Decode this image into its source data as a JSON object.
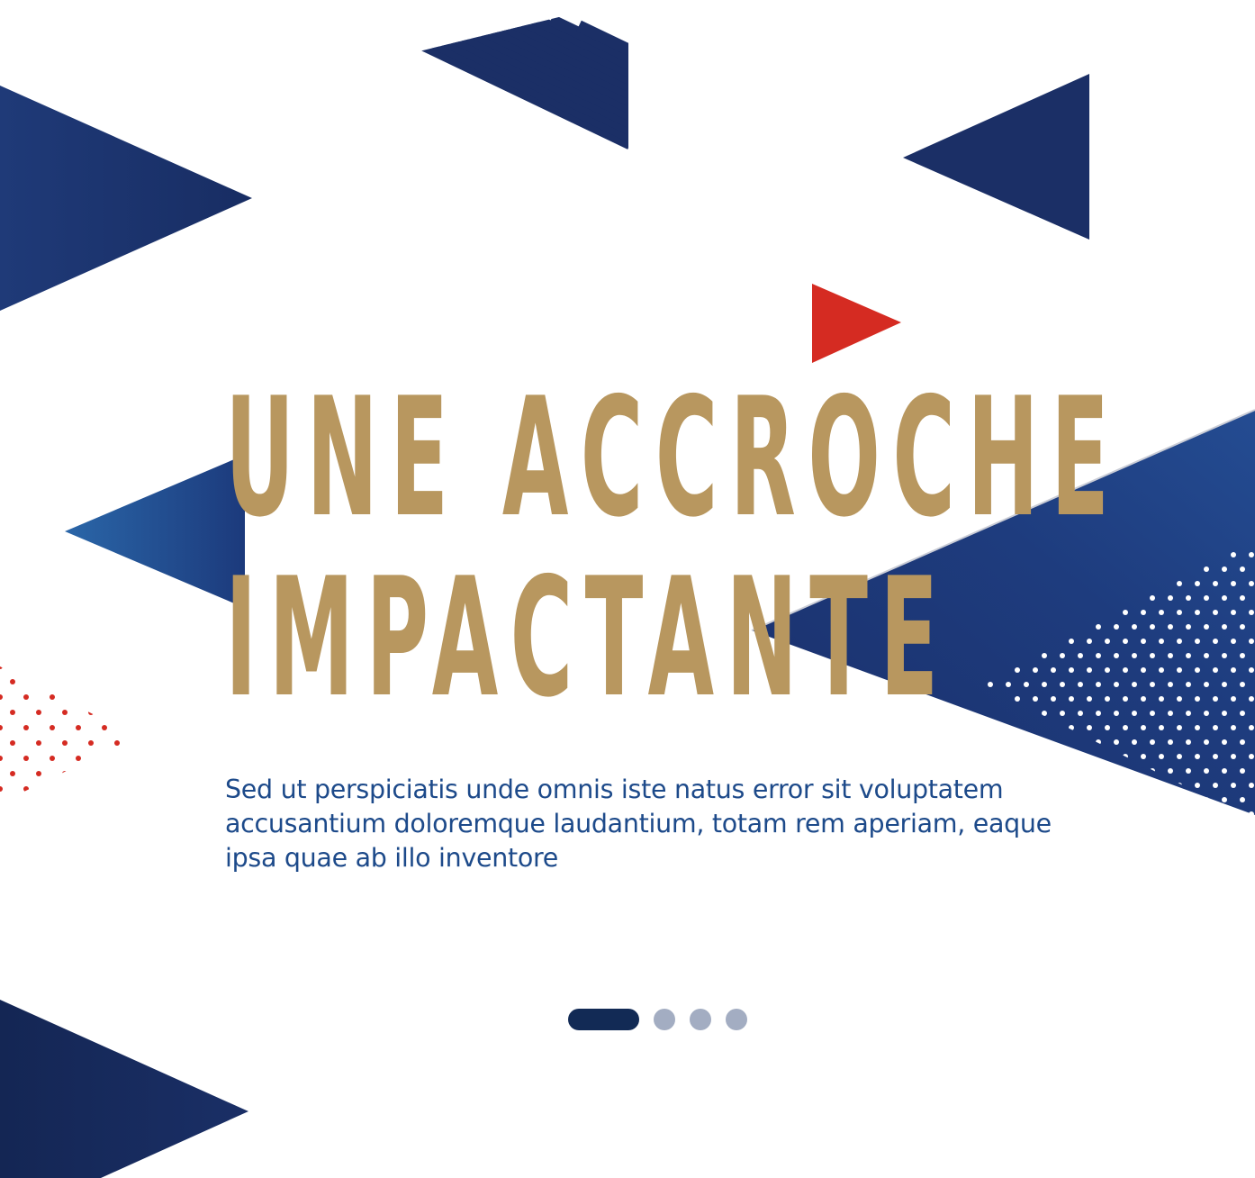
{
  "hero": {
    "headline_line1": "UNE ACCROCHE",
    "headline_line2": "IMPACTANTE",
    "body": "Sed ut perspiciatis unde omnis iste natus error sit voluptatem accusantium doloremque laudantium, totam rem aperiam, eaque ipsa quae ab illo inventore"
  },
  "pager": {
    "count": 4,
    "active_index": 0
  },
  "colors": {
    "background": "#ffffff",
    "navy": "#1b2f66",
    "navy_dark": "#13224d",
    "blue_light": "#2a66a8",
    "gold": "#b8975f",
    "red": "#d52b22",
    "body_text": "#1d4a8a",
    "pager_active": "#122a55",
    "pager_inactive": "#a3adc2"
  }
}
